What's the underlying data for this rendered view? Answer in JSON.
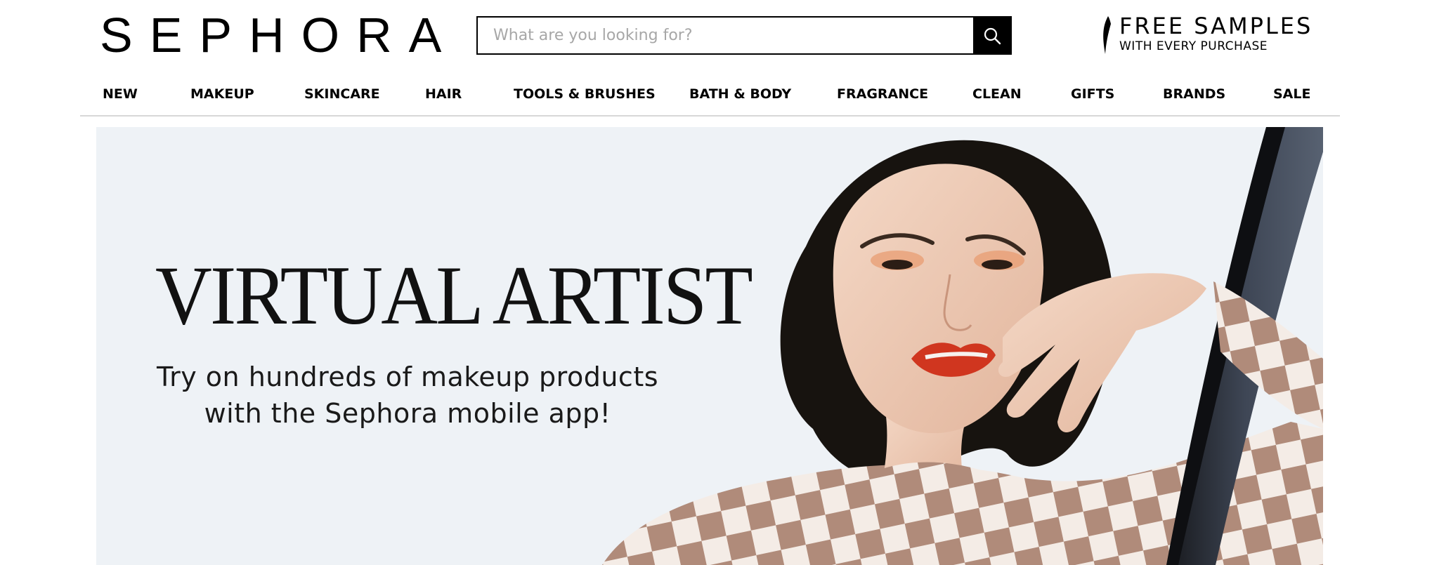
{
  "header": {
    "logo_text": "SEPHORA",
    "search": {
      "placeholder": "What are you looking for?",
      "value": ""
    },
    "promo": {
      "title": "FREE SAMPLES",
      "subtitle": "WITH EVERY PURCHASE"
    }
  },
  "nav": {
    "items": [
      {
        "label": "NEW"
      },
      {
        "label": "MAKEUP"
      },
      {
        "label": "SKINCARE"
      },
      {
        "label": "HAIR"
      },
      {
        "label": "TOOLS & BRUSHES"
      },
      {
        "label": "BATH & BODY"
      },
      {
        "label": "FRAGRANCE"
      },
      {
        "label": "CLEAN"
      },
      {
        "label": "GIFTS"
      },
      {
        "label": "BRANDS"
      },
      {
        "label": "SALE"
      }
    ]
  },
  "hero": {
    "title": "VIRTUAL ARTIST",
    "subtitle_line1": "Try on hundreds of makeup products",
    "subtitle_line2": "with the Sephora mobile app!"
  },
  "icons": {
    "search": "search-icon",
    "promo": "sephora-flame-icon"
  },
  "colors": {
    "brand_black": "#000000",
    "hero_background": "#eef2f6",
    "nav_divider": "#d8d8d8"
  }
}
